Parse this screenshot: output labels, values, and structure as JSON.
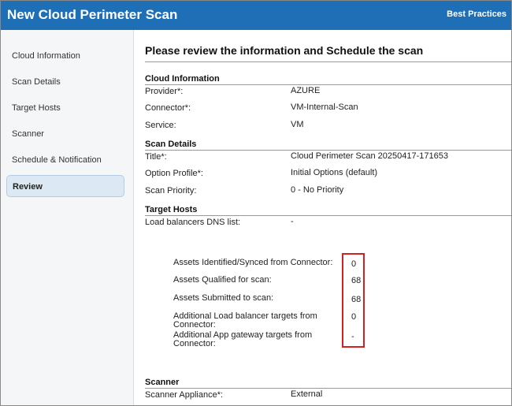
{
  "header": {
    "title": "New Cloud Perimeter Scan",
    "best_practices": "Best Practices"
  },
  "sidebar": {
    "items": [
      {
        "label": "Cloud Information"
      },
      {
        "label": "Scan Details"
      },
      {
        "label": "Target Hosts"
      },
      {
        "label": "Scanner"
      },
      {
        "label": "Schedule & Notification"
      },
      {
        "label": "Review",
        "active": true
      }
    ]
  },
  "main": {
    "page_title": "Please review the information and Schedule the scan",
    "cloud_information": {
      "heading": "Cloud Information",
      "provider_label": "Provider*:",
      "provider_value": "AZURE",
      "connector_label": "Connector*:",
      "connector_value": "VM-Internal-Scan",
      "service_label": "Service:",
      "service_value": "VM"
    },
    "scan_details": {
      "heading": "Scan Details",
      "title_label": "Title*:",
      "title_value": "Cloud Perimeter Scan 20250417-171653",
      "option_profile_label": "Option Profile*:",
      "option_profile_value": "Initial Options (default)",
      "scan_priority_label": "Scan Priority:",
      "scan_priority_value": "0 - No Priority"
    },
    "target_hosts": {
      "heading": "Target Hosts",
      "lb_dns_label": "Load balancers DNS list:",
      "lb_dns_value": "-",
      "assets": [
        {
          "label": "Assets Identified/Synced from Connector:",
          "value": "0"
        },
        {
          "label": "Assets Qualified for scan:",
          "value": "68"
        },
        {
          "label": "Assets Submitted to scan:",
          "value": "68"
        },
        {
          "label": "Additional Load balancer targets from Connector:",
          "value": "0"
        },
        {
          "label": "Additional App gateway targets from Connector:",
          "value": "-"
        }
      ],
      "highlight_color": "#d32020"
    },
    "scanner": {
      "heading": "Scanner",
      "appliance_label": "Scanner Appliance*:",
      "appliance_value": "External"
    }
  },
  "colors": {
    "header_bg": "#1f6fb7",
    "active_nav_bg": "#dce9f5"
  }
}
